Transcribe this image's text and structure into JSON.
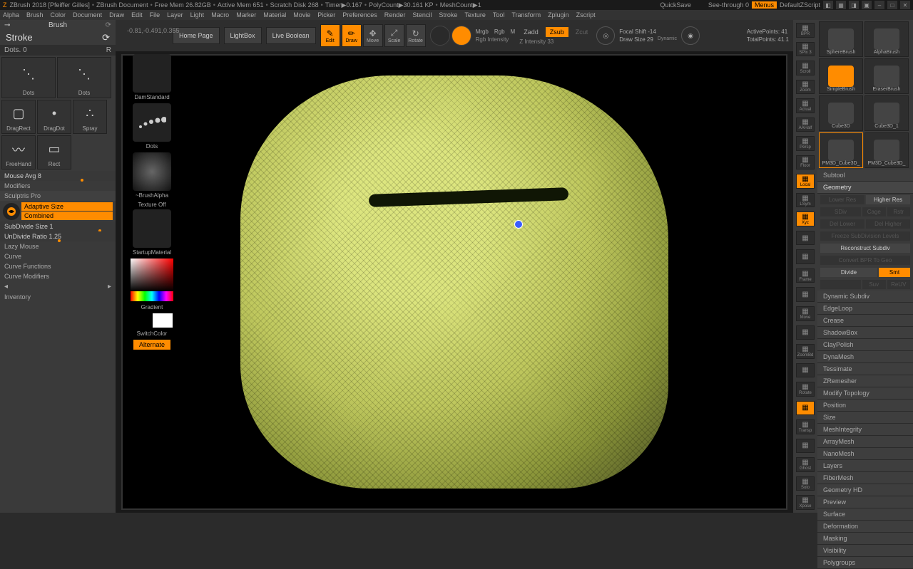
{
  "titlebar": {
    "app": "ZBrush 2018 [Pfeiffer Gilles]",
    "doc": "ZBrush Document",
    "freemem": "Free Mem 26.82GB",
    "activemem": "Active Mem 651",
    "scratch": "Scratch Disk 268",
    "timer": "Timer▶0.167",
    "polycount": "PolyCount▶30.161 KP",
    "meshcount": "MeshCount▶1",
    "quicksave": "QuickSave",
    "seethrough": "See-through  0",
    "menus": "Menus",
    "defaultscript": "DefaultZScript"
  },
  "menu": [
    "Alpha",
    "Brush",
    "Color",
    "Document",
    "Draw",
    "Edit",
    "File",
    "Layer",
    "Light",
    "Macro",
    "Marker",
    "Material",
    "Movie",
    "Picker",
    "Preferences",
    "Render",
    "Stencil",
    "Stroke",
    "Texture",
    "Tool",
    "Transform",
    "Zplugin",
    "Zscript"
  ],
  "left": {
    "brush": "Brush",
    "stroke": "Stroke",
    "dotsbar_left": "Dots. 0",
    "dotsbar_right": "R",
    "tools": [
      "Dots",
      "Dots",
      "DragRect",
      "DragDot",
      "Spray",
      "FreeHand",
      "Rect"
    ],
    "mouseavg": "Mouse Avg 8",
    "modifiers": "Modifiers",
    "sculptris": "Sculptris Pro",
    "adaptive": "Adaptive Size",
    "combined": "Combined",
    "subdivide": "SubDivide Size 1",
    "undivide": "UnDivide Ratio 1.25",
    "lazy": "Lazy Mouse",
    "curve": "Curve",
    "curvefn": "Curve Functions",
    "curvemod": "Curve Modifiers",
    "inventory": "Inventory"
  },
  "center": {
    "damstandard": "DamStandard",
    "dots": "Dots",
    "brushalpha": "~BrushAlpha",
    "textureoff": "Texture Off",
    "startup": "StartupMaterial",
    "gradient": "Gradient",
    "switchcolor": "SwitchColor",
    "alternate": "Alternate"
  },
  "top": {
    "coords": "-0.81,-0.491,0.355",
    "homepage": "Home Page",
    "lightbox": "LightBox",
    "liveboolean": "Live Boolean",
    "gizmos": [
      "Edit",
      "Draw",
      "Move",
      "Scale",
      "Rotate"
    ],
    "mrgb": "Mrgb",
    "rgb": "Rgb",
    "m": "M",
    "rgbintensity": "Rgb Intensity",
    "zadd": "Zadd",
    "zsub": "Zsub",
    "zcut": "Zcut",
    "zintensity": "Z Intensity 33",
    "focalshift": "Focal Shift -14",
    "drawsize": "Draw Size 29",
    "dynamic": "Dynamic",
    "activepoints": "ActivePoints: 41",
    "totalpoints": "TotalPoints: 41.1"
  },
  "righticons": [
    "BPR",
    "SPix 3",
    "Scroll",
    "Zoom",
    "Actual",
    "AAHalf",
    "Persp",
    "Floor",
    "Local",
    "LSym",
    "Xyz",
    "",
    "",
    "Frame",
    "",
    "Move",
    "",
    "ZoomBd",
    "",
    "Rotate",
    "",
    "Transp",
    "",
    "Ghost",
    "Solo",
    "Xpose"
  ],
  "right": {
    "brushes": [
      "SphereBrush",
      "AlphaBrush",
      "SimpleBrush",
      "EraserBrush",
      "Cube3D",
      "Cube3D_1",
      "PM3D_Cube3D_",
      "PM3D_Cube3D_"
    ],
    "subtool": "Subtool",
    "geometry": "Geometry",
    "lowerres": "Lower Res",
    "higherres": "Higher Res",
    "sdiv": "SDiv",
    "cage": "Cage",
    "rstr": "Rstr",
    "dellower": "Del Lower",
    "delhigher": "Del Higher",
    "freeze": "Freeze SubDivision Levels",
    "reconstruct": "Reconstruct Subdiv",
    "convertbpr": "Convert BPR To Geo",
    "divide": "Divide",
    "smt": "Smt",
    "suv": "Suv",
    "reuv": "ReUV",
    "sections": [
      "Dynamic Subdiv",
      "EdgeLoop",
      "Crease",
      "ShadowBox",
      "ClayPolish",
      "DynaMesh",
      "Tessimate",
      "ZRemesher",
      "Modify Topology",
      "Position",
      "Size",
      "MeshIntegrity"
    ],
    "lower": [
      "ArrayMesh",
      "NanoMesh",
      "Layers",
      "FiberMesh",
      "Geometry HD",
      "Preview",
      "Surface",
      "Deformation",
      "Masking",
      "Visibility",
      "Polygroups"
    ]
  }
}
